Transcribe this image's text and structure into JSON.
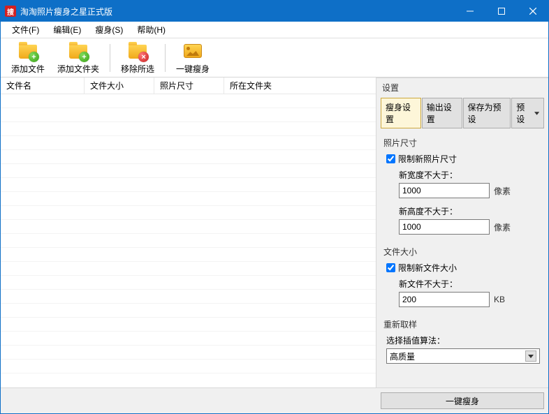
{
  "window": {
    "title": "淘淘照片瘦身之星正式版"
  },
  "menu": {
    "file": "文件(F)",
    "edit": "编辑(E)",
    "slim": "瘦身(S)",
    "help": "帮助(H)"
  },
  "toolbar": {
    "add_file": "添加文件",
    "add_folder": "添加文件夹",
    "remove_sel": "移除所选",
    "one_key": "一键瘦身"
  },
  "table": {
    "col_filename": "文件名",
    "col_filesize": "文件大小",
    "col_photosize": "照片尺寸",
    "col_folder": "所在文件夹"
  },
  "settings": {
    "title": "设置",
    "tabs": {
      "slim": "瘦身设置",
      "output": "输出设置",
      "save_preset": "保存为预设",
      "preset": "预设"
    },
    "photo_size": {
      "group": "照片尺寸",
      "limit_cb": "限制新照片尺寸",
      "width_label": "新宽度不大于：",
      "width_value": "1000",
      "height_label": "新高度不大于：",
      "height_value": "1000",
      "unit": "像素"
    },
    "file_size": {
      "group": "文件大小",
      "limit_cb": "限制新文件大小",
      "label": "新文件不大于：",
      "value": "200",
      "unit": "KB"
    },
    "resample": {
      "group": "重新取样",
      "label": "选择插值算法：",
      "value": "高质量"
    }
  },
  "footer": {
    "button": "一键瘦身"
  }
}
